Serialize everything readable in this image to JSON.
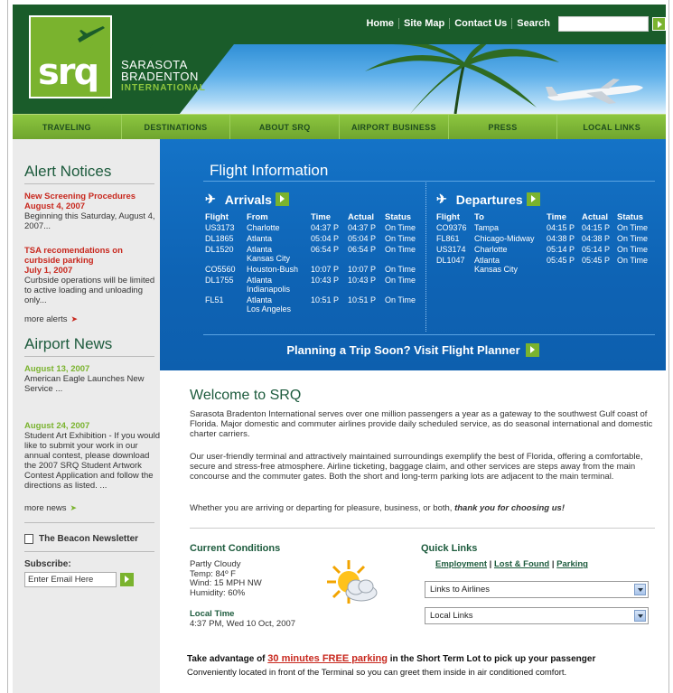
{
  "header": {
    "logo": "srq",
    "brand_line1": "SARASOTA",
    "brand_line2": "BRADENTON",
    "brand_line3": "INTERNATIONAL",
    "top_nav": [
      "Home",
      "Site Map",
      "Contact Us",
      "Search"
    ],
    "search_placeholder": ""
  },
  "main_nav": [
    "TRAVELING",
    "DESTINATIONS",
    "ABOUT SRQ",
    "AIRPORT BUSINESS",
    "PRESS",
    "LOCAL LINKS"
  ],
  "sidebar": {
    "alert_heading": "Alert Notices",
    "alerts": [
      {
        "title": "New Screening Procedures",
        "date": "August 4, 2007",
        "body": "Beginning this Saturday, August 4, 2007..."
      },
      {
        "title": "TSA recomendations on curbside parking",
        "date": "July 1, 2007",
        "body": "Curbside operations will be limited to active loading and unloading only..."
      }
    ],
    "more_alerts": "more alerts",
    "news_heading": "Airport News",
    "news": [
      {
        "date": "August 13, 2007",
        "body": "American Eagle Launches New Service ..."
      },
      {
        "date": "August 24, 2007",
        "body": "Student Art Exhibition - If you would like to submit your work in our annual contest, please download the 2007 SRQ Student Artwork Contest Application and follow the directions as listed. ..."
      }
    ],
    "more_news": "more news",
    "newsletter": "The Beacon Newsletter",
    "subscribe_label": "Subscribe:",
    "email_placeholder": "Enter Email Here"
  },
  "flight_info": {
    "title": "Flight Information",
    "arrivals_title": "Arrivals",
    "departures_title": "Departures",
    "arrivals_columns": [
      "Flight",
      "From",
      "Time",
      "Actual",
      "Status"
    ],
    "departures_columns": [
      "Flight",
      "To",
      "Time",
      "Actual",
      "Status"
    ],
    "arrivals": [
      {
        "flight": "US3173",
        "city": "Charlotte",
        "time": "04:37 P",
        "actual": "04:37 P",
        "status": "On Time"
      },
      {
        "flight": "DL1865",
        "city": "Atlanta",
        "time": "05:04 P",
        "actual": "05:04 P",
        "status": "On Time"
      },
      {
        "flight": "DL1520",
        "city": "Atlanta",
        "city2": "Kansas City",
        "time": "06:54 P",
        "actual": "06:54 P",
        "status": "On Time"
      },
      {
        "flight": "CO5560",
        "city": "Houston-Bush",
        "time": "10:07 P",
        "actual": "10:07 P",
        "status": "On Time"
      },
      {
        "flight": "DL1755",
        "city": "Atlanta",
        "city2": "Indianapolis",
        "time": "10:43 P",
        "actual": "10:43 P",
        "status": "On Time"
      },
      {
        "flight": "FL51",
        "city": "Atlanta",
        "city2": "Los Angeles",
        "time": "10:51 P",
        "actual": "10:51 P",
        "status": "On Time"
      }
    ],
    "departures": [
      {
        "flight": "CO9376",
        "city": "Tampa",
        "time": "04:15 P",
        "actual": "04:15 P",
        "status": "On Time"
      },
      {
        "flight": "FL861",
        "city": "Chicago-Midway",
        "time": "04:38 P",
        "actual": "04:38 P",
        "status": "On Time"
      },
      {
        "flight": "US3174",
        "city": "Charlotte",
        "time": "05:14 P",
        "actual": "05:14 P",
        "status": "On Time"
      },
      {
        "flight": "DL1047",
        "city": "Atlanta",
        "city2": "Kansas City",
        "time": "05:45 P",
        "actual": "05:45 P",
        "status": "On Time"
      }
    ],
    "planner": "Planning a Trip Soon? Visit Flight Planner"
  },
  "main": {
    "welcome": "Welcome to SRQ",
    "para1": "Sarasota Bradenton International serves over one million passengers a year as a gateway to the southwest Gulf coast of Florida. Major domestic and commuter airlines provide daily scheduled service, as do seasonal international and domestic charter carriers.",
    "para2": "Our user-friendly terminal and attractively maintained surroundings exemplify the best of Florida, offering a comfortable, secure and stress-free atmosphere. Airline ticketing, baggage claim, and other services are steps away from the main concourse and the commuter gates. Both the short and long-term parking lots are adjacent to the main terminal.",
    "para3_lead": "Whether you are arriving or departing for pleasure, business, or both,",
    "para3_em": "thank you for choosing us!",
    "conditions_heading": "Current Conditions",
    "weather": [
      "Partly Cloudy",
      "Temp: 84º F",
      "Wind: 15 MPH NW",
      "Humidity: 60%"
    ],
    "local_time_heading": "Local Time",
    "local_time": "4:37 PM, Wed 10 Oct, 2007",
    "quick_links_heading": "Quick Links",
    "quick_links": [
      "Employment",
      "Lost & Found",
      "Parking"
    ],
    "select1": "Links to Airlines",
    "select2": "Local Links",
    "promo_lead": "Take advantage of",
    "promo_link": "30 minutes FREE parking",
    "promo_tail": "in the Short Term Lot to pick up your passenger",
    "promo_line2": "Conveniently located in front of the Terminal so you can greet them inside in air conditioned comfort."
  },
  "colors": {
    "brand_green": "#7ab32e",
    "dark_green": "#1a5c2a",
    "flight_blue": "#1473c7",
    "alert_red": "#c8281e"
  }
}
